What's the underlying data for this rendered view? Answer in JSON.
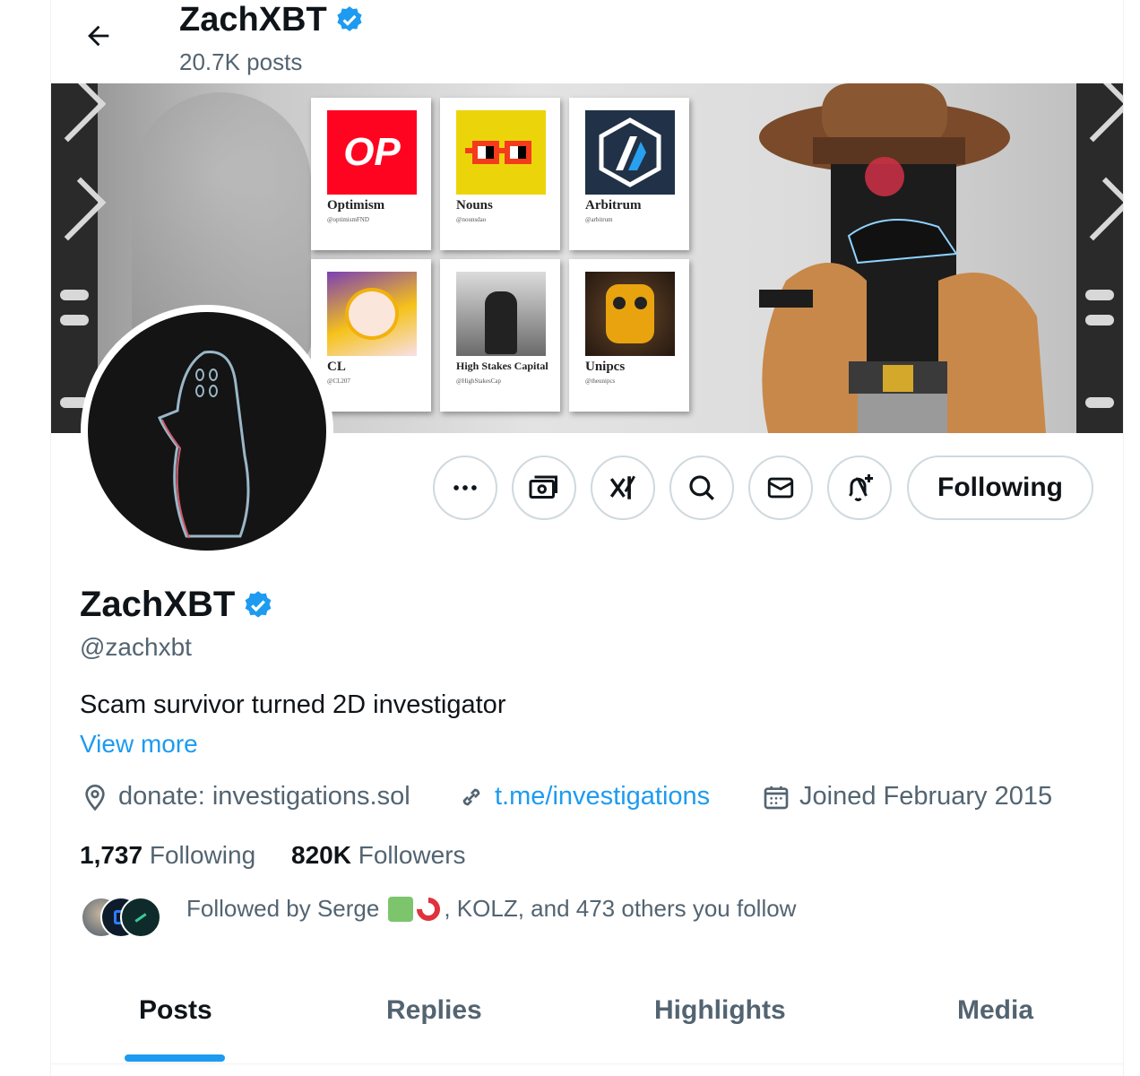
{
  "header": {
    "title": "ZachXBT",
    "post_count": "20.7K posts"
  },
  "banner": {
    "cards": [
      {
        "name": "Optimism",
        "handle": "@optimismFND",
        "logo_text": "OP"
      },
      {
        "name": "Nouns",
        "handle": "@nounsdao"
      },
      {
        "name": "Arbitrum",
        "handle": "@arbitrum"
      },
      {
        "name": "CL",
        "handle": "@CL207"
      },
      {
        "name": "High Stakes Capital",
        "handle": "@HighStakesCap"
      },
      {
        "name": "Unipcs",
        "handle": "@theunipcs"
      }
    ]
  },
  "actions": {
    "follow_label": "Following",
    "icons": [
      "more-icon",
      "tip-money-icon",
      "grok-icon",
      "search-icon",
      "message-icon",
      "notify-bell-icon"
    ]
  },
  "profile": {
    "name": "ZachXBT",
    "handle": "@zachxbt",
    "bio": "Scam survivor turned 2D investigator",
    "view_more": "View more",
    "location": "donate: investigations.sol",
    "website": "t.me/investigations",
    "joined": "Joined February 2015",
    "following_count": "1,737",
    "following_label": "Following",
    "followers_count": "820K",
    "followers_label": "Followers",
    "followed_by_prefix": "Followed by Serge",
    "followed_by_suffix": ", KOLZ, and 473 others you follow"
  },
  "tabs": [
    {
      "label": "Posts"
    },
    {
      "label": "Replies"
    },
    {
      "label": "Highlights"
    },
    {
      "label": "Media"
    }
  ],
  "colors": {
    "accent": "#1d9bf0",
    "text": "#0f1419",
    "secondary": "#536471",
    "border": "#cfd9de"
  }
}
